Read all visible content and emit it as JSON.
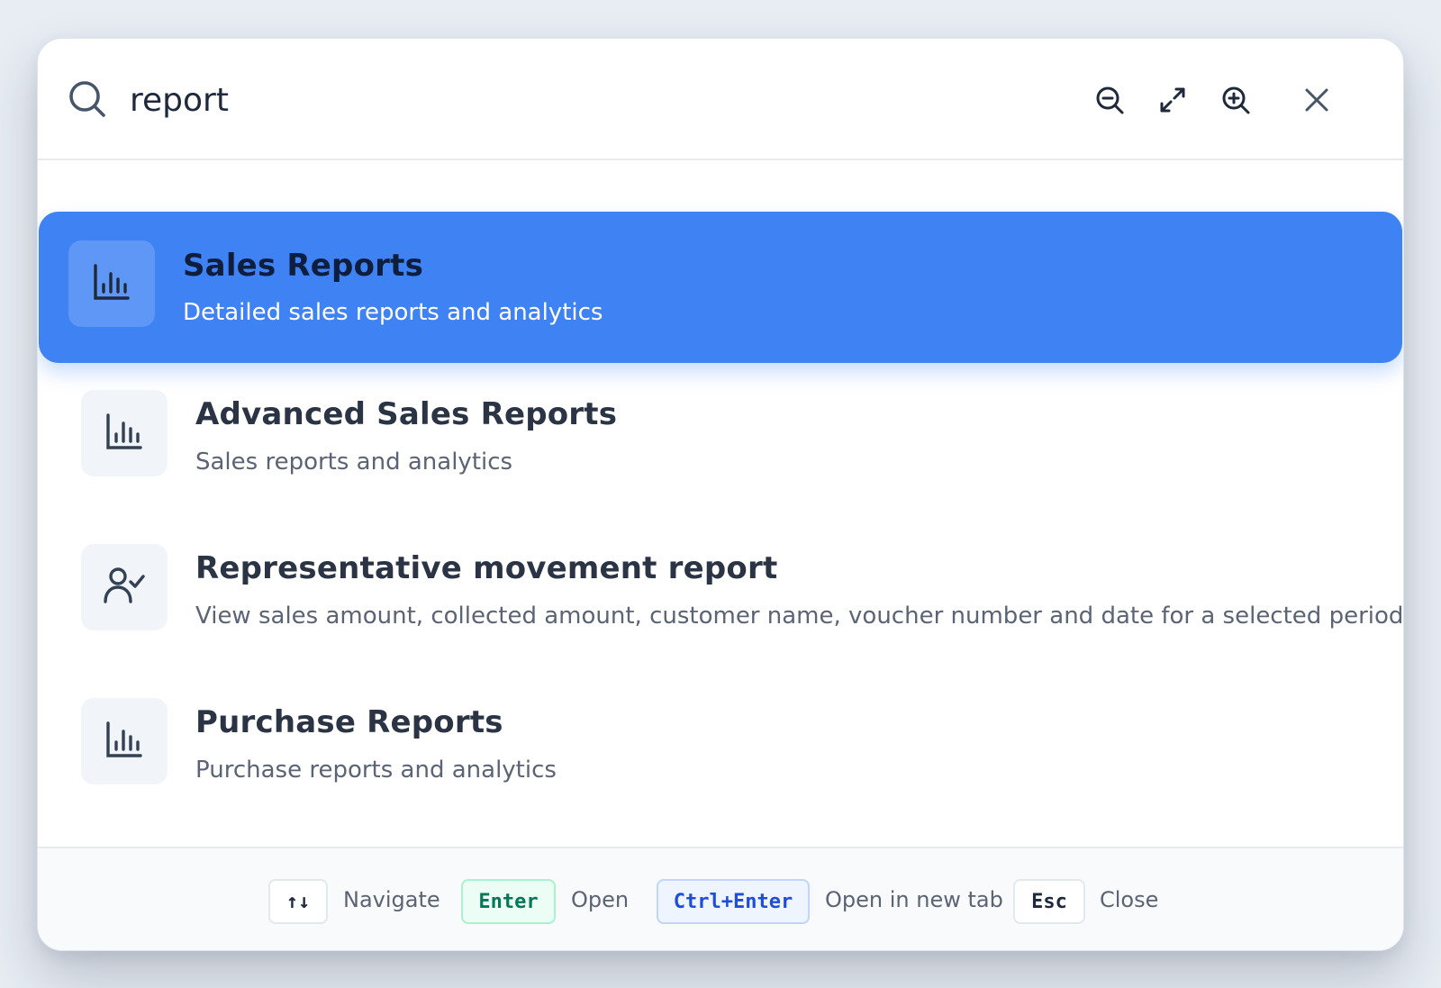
{
  "search": {
    "value": "report",
    "placeholder": ""
  },
  "header": {
    "zoom_out_icon": "zoom-out-icon",
    "expand_icon": "expand-icon",
    "zoom_in_icon": "zoom-in-icon",
    "close_icon": "close-icon"
  },
  "results": [
    {
      "title": "Sales Reports",
      "description": "Detailed sales reports and analytics",
      "icon": "bar-chart-icon",
      "selected": true
    },
    {
      "title": "Advanced Sales Reports",
      "description": "Sales reports and analytics",
      "icon": "bar-chart-icon",
      "selected": false
    },
    {
      "title": "Representative movement report",
      "description": "View sales amount, collected amount, customer name, voucher number and date for a selected period",
      "icon": "user-check-icon",
      "selected": false
    },
    {
      "title": "Purchase Reports",
      "description": "Purchase reports and analytics",
      "icon": "bar-chart-icon",
      "selected": false
    }
  ],
  "footer": {
    "navigate_key": "↑↓",
    "navigate_label": "Navigate",
    "open_key": "Enter",
    "open_label": "Open",
    "newtab_key": "Ctrl+Enter",
    "newtab_label": "Open in new tab",
    "close_key": "Esc",
    "close_label": "Close"
  },
  "colors": {
    "accent": "#3e82f4",
    "background": "#e8edf4",
    "enter_key": "#047857",
    "ctrl_enter_key": "#1d4ed8"
  }
}
